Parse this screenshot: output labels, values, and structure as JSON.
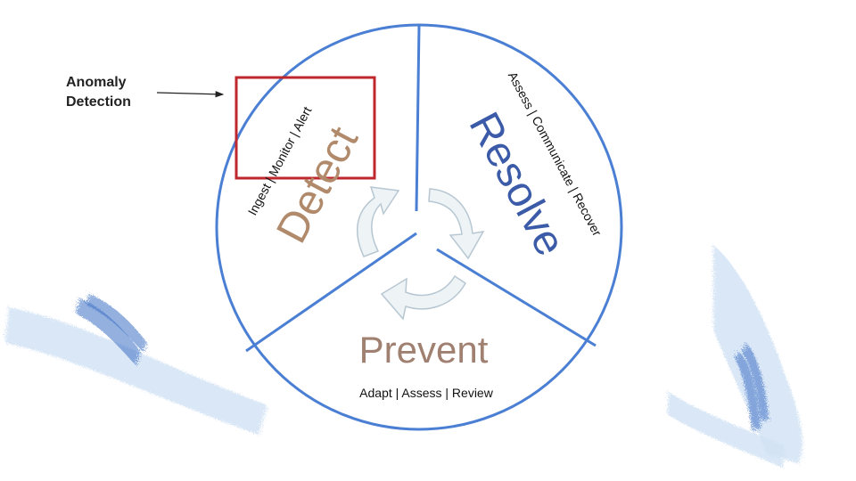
{
  "annotation": {
    "label_line1": "Anomaly",
    "label_line2": "Detection"
  },
  "segments": {
    "detect": {
      "title": "Detect",
      "steps": "Ingest | Monitor | Alert"
    },
    "resolve": {
      "title": "Resolve",
      "steps": "Assess | Communicate | Recover"
    },
    "prevent": {
      "title": "Prevent",
      "steps": "Adapt | Assess | Review"
    }
  },
  "colors": {
    "circle_stroke": "#4a7fd4",
    "detect_title": "#b08a6a",
    "resolve_title": "#3b5aa8",
    "prevent_title": "#a08070",
    "highlight_box": "#c0272d",
    "cycle_arrow_fill": "#eef3f6",
    "cycle_arrow_stroke": "#b7c7d2",
    "brush_light": "#d2e3f4",
    "brush_dark": "#3a6fc4"
  },
  "icons": {
    "cycle_arrows": "curved-arrow-icon",
    "pointer": "arrow-right-icon"
  }
}
